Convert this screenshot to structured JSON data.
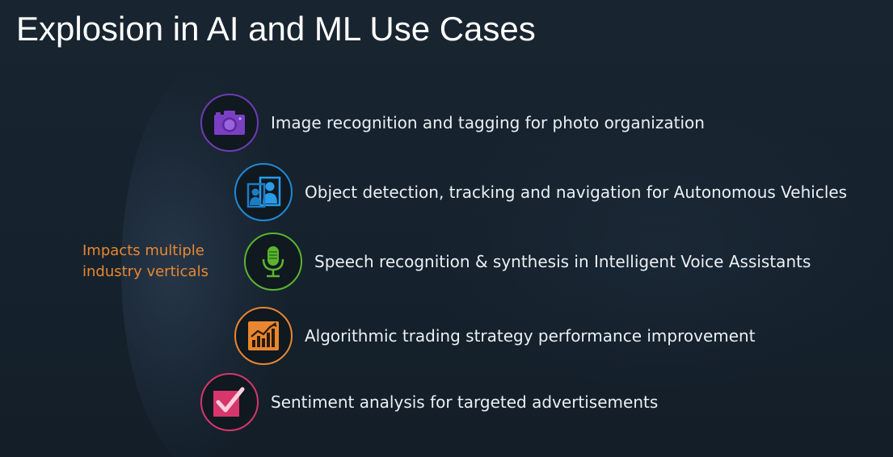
{
  "slide": {
    "title": "Explosion in AI and ML Use Cases",
    "impact": {
      "line1": "Impacts multiple",
      "line2": "industry verticals"
    },
    "use_cases": [
      {
        "label": "Image recognition and tagging for photo organization",
        "icon": "camera-icon",
        "color": "#7b3fc4"
      },
      {
        "label": "Object detection, tracking and navigation for Autonomous Vehicles",
        "icon": "people-frame-icon",
        "color": "#1e8ad6"
      },
      {
        "label": "Speech recognition & synthesis in Intelligent Voice Assistants",
        "icon": "microphone-icon",
        "color": "#5ab52e"
      },
      {
        "label": "Algorithmic trading strategy performance improvement",
        "icon": "trending-chart-icon",
        "color": "#e8872f"
      },
      {
        "label": "Sentiment analysis for targeted advertisements",
        "icon": "checkbox-check-icon",
        "color": "#d6366b"
      }
    ]
  }
}
